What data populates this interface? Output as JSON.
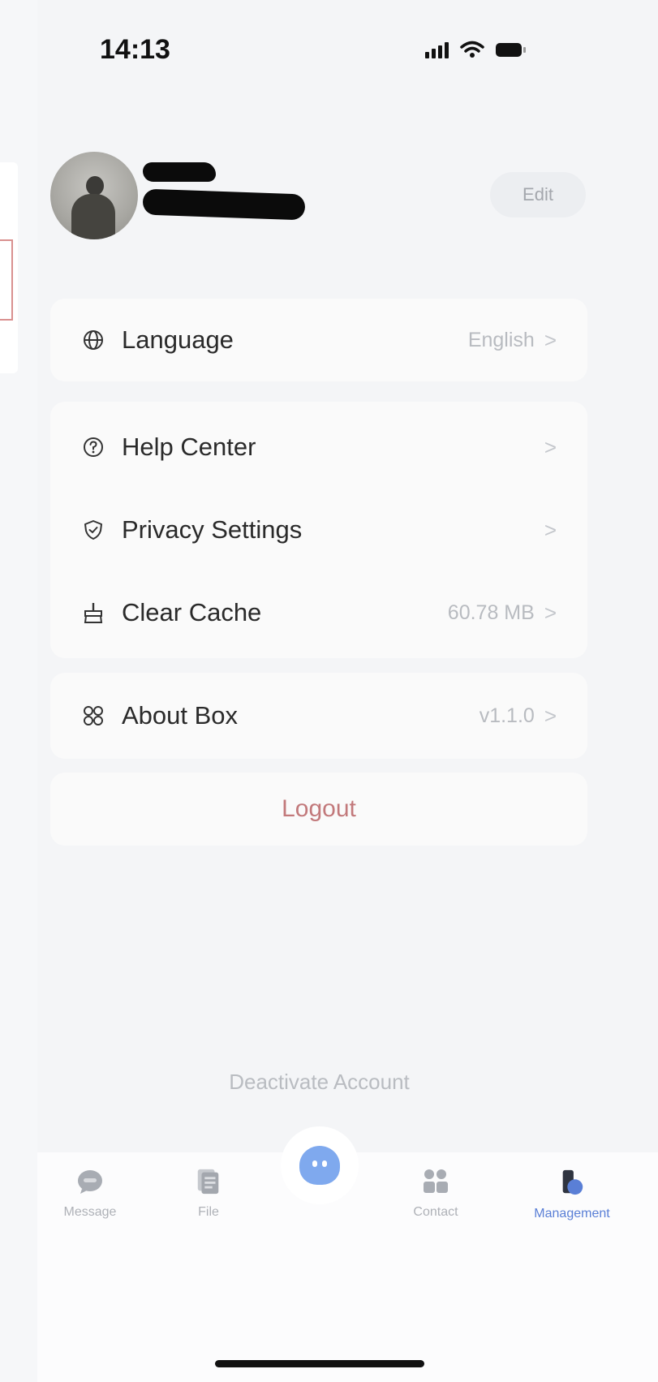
{
  "status_bar": {
    "time": "14:13"
  },
  "profile": {
    "edit_label": "Edit"
  },
  "settings": {
    "language": {
      "label": "Language",
      "value": "English"
    },
    "help": {
      "label": "Help Center"
    },
    "privacy": {
      "label": "Privacy Settings"
    },
    "cache": {
      "label": "Clear Cache",
      "value": "60.78 MB"
    },
    "about": {
      "label": "About Box",
      "value": "v1.1.0"
    },
    "chevron": ">"
  },
  "logout_label": "Logout",
  "deactivate_label": "Deactivate Account",
  "tabs": [
    {
      "label": "Message",
      "icon": "message-icon"
    },
    {
      "label": "File",
      "icon": "file-icon"
    },
    {
      "label": "",
      "icon": "assistant-icon"
    },
    {
      "label": "Contact",
      "icon": "contact-icon"
    },
    {
      "label": "Management",
      "icon": "management-icon"
    }
  ],
  "colors": {
    "background": "#f4f5f7",
    "logout_text": "#c2797b",
    "active_tab": "#5a7fd6",
    "assistant": "#7fa9ee"
  }
}
